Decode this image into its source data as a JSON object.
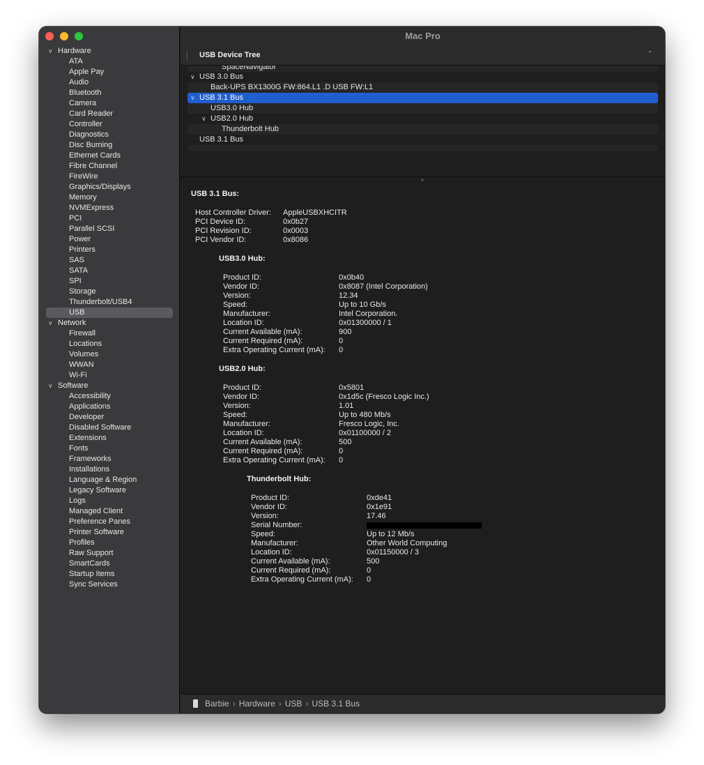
{
  "window": {
    "title": "Mac Pro"
  },
  "sidebar": {
    "groups": [
      {
        "label": "Hardware",
        "items": [
          "ATA",
          "Apple Pay",
          "Audio",
          "Bluetooth",
          "Camera",
          "Card Reader",
          "Controller",
          "Diagnostics",
          "Disc Burning",
          "Ethernet Cards",
          "Fibre Channel",
          "FireWire",
          "Graphics/Displays",
          "Memory",
          "NVMExpress",
          "PCI",
          "Parallel SCSI",
          "Power",
          "Printers",
          "SAS",
          "SATA",
          "SPI",
          "Storage",
          "Thunderbolt/USB4",
          "USB"
        ]
      },
      {
        "label": "Network",
        "items": [
          "Firewall",
          "Locations",
          "Volumes",
          "WWAN",
          "Wi-Fi"
        ]
      },
      {
        "label": "Software",
        "items": [
          "Accessibility",
          "Applications",
          "Developer",
          "Disabled Software",
          "Extensions",
          "Fonts",
          "Frameworks",
          "Installations",
          "Language & Region",
          "Legacy Software",
          "Logs",
          "Managed Client",
          "Preference Panes",
          "Printer Software",
          "Profiles",
          "Raw Support",
          "SmartCards",
          "Startup Items",
          "Sync Services"
        ]
      }
    ],
    "selected": "USB",
    "chevron_icon": "chevron-down-icon"
  },
  "device_tree": {
    "header": "USB Device Tree",
    "rows": {
      "r0": "SpaceNavigator",
      "r1": "USB 3.0 Bus",
      "r2": "Back-UPS BX1300G FW:864.L1 .D USB FW:L1",
      "r3": "USB 3.1 Bus",
      "r4": "USB3.0 Hub",
      "r5": "USB2.0 Hub",
      "r6": "Thunderbolt Hub",
      "r7": "USB 3.1 Bus"
    }
  },
  "details": {
    "title": "USB 3.1 Bus:",
    "bus": {
      "keys": [
        "Host Controller Driver:",
        "PCI Device ID:",
        "PCI Revision ID:",
        "PCI Vendor ID:"
      ],
      "values": [
        "AppleUSBXHCITR",
        "0x0b27",
        "0x0003",
        "0x8086"
      ]
    },
    "hub30": {
      "title": "USB3.0 Hub:",
      "keys": [
        "Product ID:",
        "Vendor ID:",
        "Version:",
        "Speed:",
        "Manufacturer:",
        "Location ID:",
        "Current Available (mA):",
        "Current Required (mA):",
        "Extra Operating Current (mA):"
      ],
      "values": [
        "0x0b40",
        "0x8087  (Intel Corporation)",
        "12.34",
        "Up to 10 Gb/s",
        "Intel Corporation.",
        "0x01300000 / 1",
        "900",
        "0",
        "0"
      ]
    },
    "hub20": {
      "title": "USB2.0 Hub:",
      "keys": [
        "Product ID:",
        "Vendor ID:",
        "Version:",
        "Speed:",
        "Manufacturer:",
        "Location ID:",
        "Current Available (mA):",
        "Current Required (mA):",
        "Extra Operating Current (mA):"
      ],
      "values": [
        "0x5801",
        "0x1d5c  (Fresco Logic Inc.)",
        "1.01",
        "Up to 480 Mb/s",
        "Fresco Logic, Inc.",
        "0x01100000 / 2",
        "500",
        "0",
        "0"
      ]
    },
    "tbhub": {
      "title": "Thunderbolt Hub:",
      "keys": [
        "Product ID:",
        "Vendor ID:",
        "Version:",
        "Serial Number:",
        "Speed:",
        "Manufacturer:",
        "Location ID:",
        "Current Available (mA):",
        "Current Required (mA):",
        "Extra Operating Current (mA):"
      ],
      "values": [
        "0xde41",
        "0x1e91",
        "17.46",
        "",
        "Up to 12 Mb/s",
        "Other World Computing",
        "0x01150000 / 3",
        "500",
        "0",
        "0"
      ]
    }
  },
  "breadcrumb": {
    "c1": "Barbie",
    "c2": "Hardware",
    "c3": "USB",
    "c4": "USB 3.1 Bus",
    "sep": "›"
  }
}
